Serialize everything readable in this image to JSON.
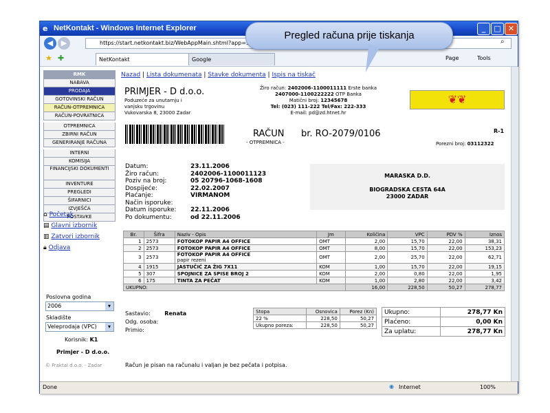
{
  "window": {
    "title": "NetKontakt - Windows Internet Explorer",
    "url": "https://start.netkontakt.biz/WebAppMain.shtml?app=SKL",
    "tab1": "NetKontakt",
    "tab2": "Google",
    "page_menu": "Page",
    "tools_menu": "Tools"
  },
  "callout": "Pregled računa prije tiskanja",
  "sidebar": {
    "header": "RMK",
    "items": [
      "NABAVA",
      "PRODAJA",
      "GOTOVINSKI RAČUN",
      "RAČUN-OTPREMNICA",
      "RAČUN-POVRATNICA",
      "OTPREMNICA",
      "ZBIRNI RAČUN",
      "GENERIRANJE RAČUNA",
      "INTERNI",
      "KOMISIJA",
      "FINANCIJSKI DOKUMENTI",
      "INVENTURE",
      "PREGLEDI",
      "ŠIFARNICI",
      "IZVJEŠĆA",
      "POSTAVKE"
    ],
    "links": [
      "Početak",
      "Glavni izbornik",
      "Zatvori izbornik",
      "Odjava"
    ],
    "year_label": "Poslovna godina",
    "year_value": "2006",
    "store_label": "Skladište",
    "store_value": "Veleprodaja (VPC)",
    "user_label": "Korisnik:",
    "user_value": "K1",
    "company": "Primjer - D d.o.o.",
    "footer": "© Fraktal d.o.o. - Zadar"
  },
  "nav": {
    "back": "Nazad",
    "list": "Lista dokumenata",
    "items": "Stavke dokumenta",
    "print": "Ispis na tiskač",
    "sep": "|"
  },
  "company": {
    "name": "PRIMJER - D d.o.o.",
    "line1": "Poduzeće za unutarnju i",
    "line2": "vanjsku trgovinu",
    "line3": "Vukovarska 8, 23000 Zadar",
    "acc1_label": "Žiro račun:",
    "acc1": "2402006-1100011111",
    "acc1_bank": "Erste banka",
    "acc2": "2407000-1100222222",
    "acc2_bank": "OTP Banka",
    "mb_label": "Matični broj:",
    "mb": "12345678",
    "tel": "Tel: (023) 111-222 Tel/Fax: 222-333",
    "email": "E-mail: pd@zd.htnet.hr"
  },
  "doc": {
    "title": "RAČUN",
    "number": "br. RO-2079/0106",
    "subtitle": "- OTPREMNICA -",
    "copy": "R-1",
    "tax_label": "Porezni broj:",
    "tax_no": "03112322"
  },
  "info": [
    [
      "Datum:",
      "23.11.2006"
    ],
    [
      "Žiro račun:",
      "2402006-1100011123"
    ],
    [
      "Poziv na broj:",
      "05 20796-1068-1608"
    ],
    [
      "Dospijeće:",
      "22.02.2007"
    ],
    [
      "Plaćanje:",
      "VIRMANOM"
    ],
    [
      "Način isporuke:",
      ""
    ],
    [
      "Datum isporuke:",
      "22.11.2006"
    ],
    [
      "Po dokumentu:",
      "od 22.11.2006"
    ]
  ],
  "buyer": {
    "name": "MARASKA D.D.",
    "street": "BIOGRADSKA CESTA 64A",
    "city": "23000 ZADAR"
  },
  "table": {
    "headers": [
      "Br.",
      "Šifra",
      "Naziv - Opis",
      "Jm",
      "Količina",
      "VPC",
      "PDV %",
      "Iznos"
    ],
    "rows": [
      [
        "1",
        "2573",
        "FOTOKOP PAPIR A4 OFFICE",
        "",
        "OMT",
        "2,00",
        "15,70",
        "22,00",
        "38,31"
      ],
      [
        "2",
        "2573",
        "FOTOKOP PAPIR A4 OFFICE",
        "",
        "OMT",
        "8,00",
        "15,70",
        "22,00",
        "153,23"
      ],
      [
        "3",
        "2573",
        "FOTOKOP PAPIR A4 OFFICE",
        "papir rezeni",
        "OMT",
        "2,00",
        "25,70",
        "22,00",
        "62,71"
      ],
      [
        "4",
        "1915",
        "JASTUČIĆ ZA ŽIG 7X11",
        "",
        "KOM",
        "1,00",
        "15,70",
        "22,00",
        "19,15"
      ],
      [
        "5",
        "307",
        "SPOJNICE ZA SPISE BROJ 2",
        "",
        "KOM",
        "2,00",
        "0,80",
        "22,00",
        "1,95"
      ],
      [
        "6",
        "175",
        "TINTA ZA PEČAT",
        "",
        "KOM",
        "1,00",
        "2,80",
        "22,00",
        "3,42"
      ]
    ],
    "total_label": "UKUPNO:",
    "total": [
      "16,00",
      "228,50",
      "50,27",
      "278,77"
    ]
  },
  "signature": {
    "issued_label": "Sastavio:",
    "issued": "Renata",
    "resp_label": "Odg. osoba:",
    "recv_label": "Primio:"
  },
  "tax_table": {
    "headers": [
      "Stopa",
      "Osnovica",
      "Porez (Kn)"
    ],
    "row": [
      "22 %",
      "228,50",
      "50,27"
    ],
    "total_label": "Ukupno poreza:",
    "total": [
      "228,50",
      "50,27"
    ]
  },
  "summary": [
    [
      "Ukupno:",
      "278,77 Kn"
    ],
    [
      "Plaćeno:",
      "0,00 Kn"
    ],
    [
      "Za uplatu:",
      "278,77 Kn"
    ]
  ],
  "note": "Račun je pisan na računalu i valjan je bez pečata i potpisa.",
  "status": {
    "left": "Done",
    "zone": "Internet",
    "zoom": "100%"
  },
  "colors": {
    "titlebar": "#1848c8",
    "selected": "#2a3a9b",
    "logo_bg": "#f2e20a",
    "logo_fg": "#d42020"
  }
}
